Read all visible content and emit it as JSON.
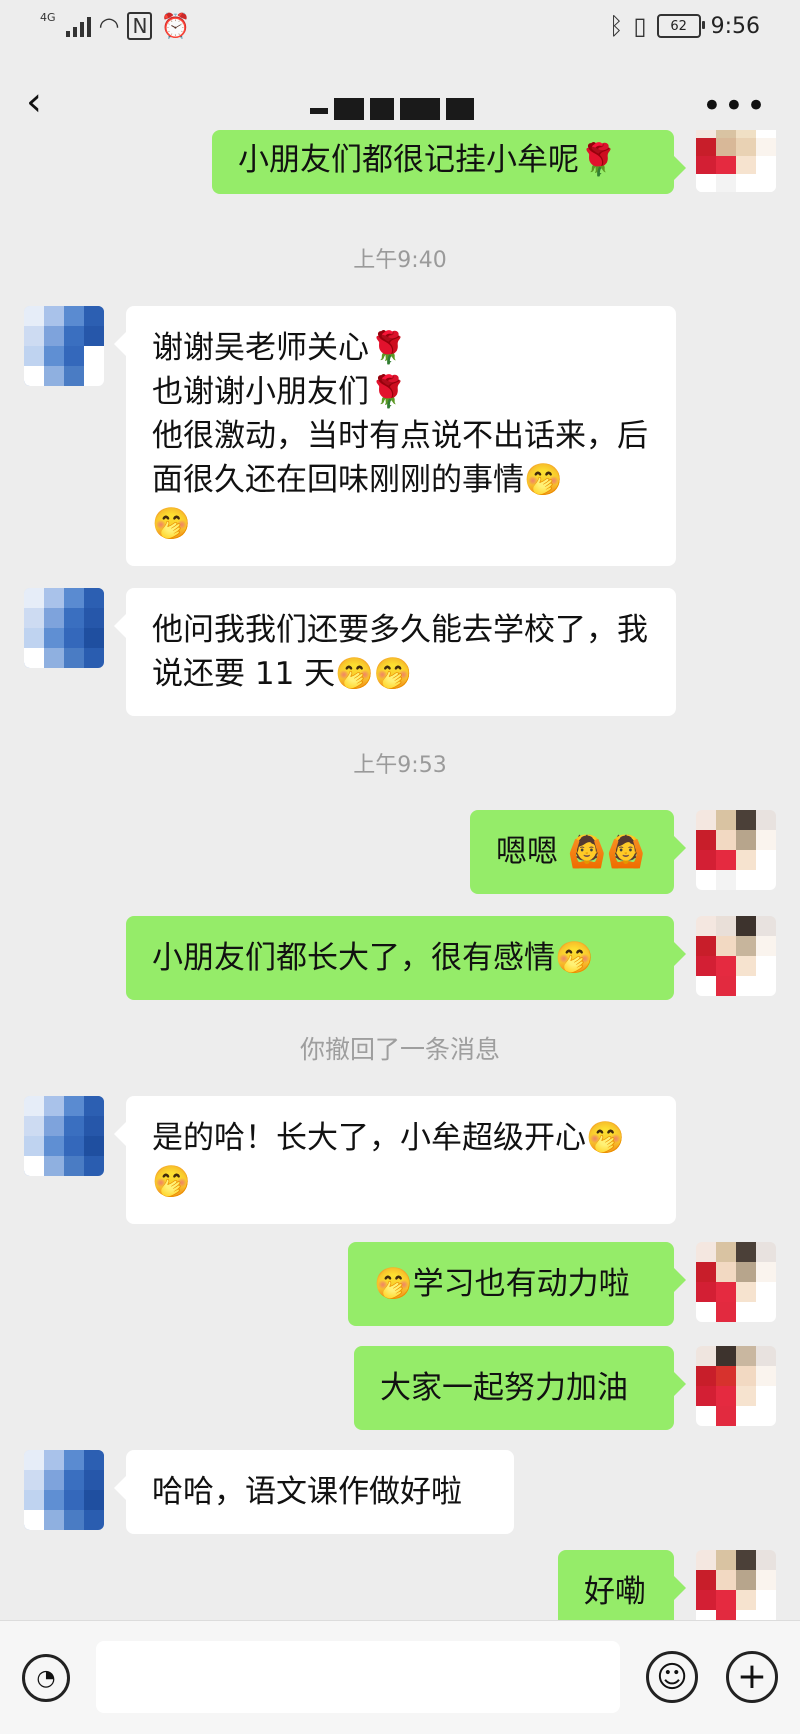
{
  "status_bar": {
    "signal_label": "4G",
    "battery": "62",
    "time": "9:56"
  },
  "nav": {
    "back_icon": "chevron-left-icon",
    "more_icon": "ellipsis-icon"
  },
  "messages": {
    "m0": "小朋友们都很记挂小牟呢🌹",
    "t1": "上午9:40",
    "m1": "谢谢吴老师关心🌹\n也谢谢小朋友们🌹\n他很激动，当时有点说不出话来，后面很久还在回味刚刚的事情🤭\n🤭",
    "m2": "他问我我们还要多久能去学校了，我说还要 11 天🤭🤭",
    "t2": "上午9:53",
    "m3": "嗯嗯 🙆🙆",
    "m4": "小朋友们都长大了，很有感情🤭",
    "recall": "你撤回了一条消息",
    "m5": "是的哈！长大了，小牟超级开心🤭\n🤭",
    "m6": "🤭学习也有动力啦",
    "m7": "大家一起努力加油",
    "m8": "哈哈，语文课作做好啦",
    "m9": "好嘞"
  },
  "input_bar": {
    "voice_icon": "voice-icon",
    "emoji_icon": "smiley-icon",
    "plus_icon": "plus-icon"
  },
  "colors": {
    "background": "#ededed",
    "outgoing_bubble": "#95ec69",
    "incoming_bubble": "#ffffff"
  }
}
